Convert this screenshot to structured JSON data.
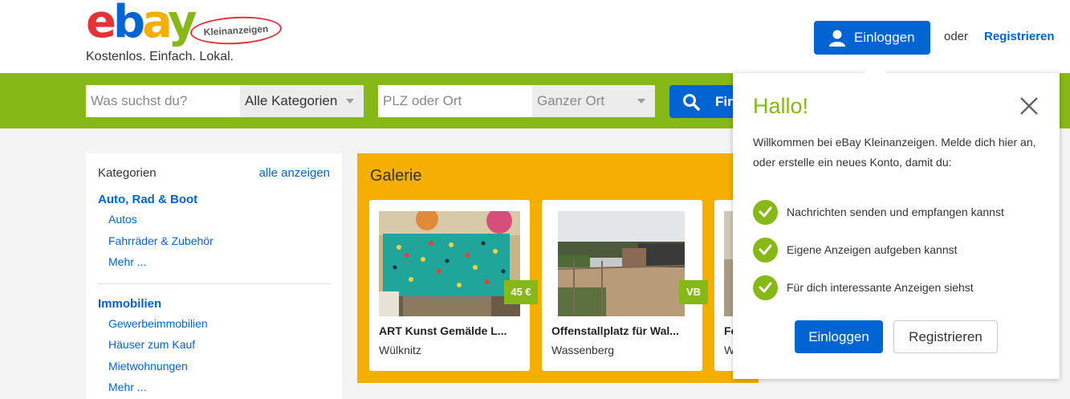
{
  "header": {
    "logo_word": [
      "e",
      "b",
      "a",
      "y"
    ],
    "logo_badge": "Kleinanzeigen",
    "tagline": "Kostenlos. Einfach. Lokal.",
    "login_label": "Einloggen",
    "or_label": "oder",
    "register_label": "Registrieren"
  },
  "search": {
    "query_placeholder": "Was suchst du?",
    "category_selected": "Alle Kategorien",
    "location_placeholder": "PLZ oder Ort",
    "radius_selected": "Ganzer Ort",
    "find_label": "Finden"
  },
  "categories": {
    "title": "Kategorien",
    "all_link": "alle anzeigen",
    "groups": [
      {
        "name": "Auto, Rad & Boot",
        "items": [
          "Autos",
          "Fahrräder & Zubehör",
          "Mehr ..."
        ]
      },
      {
        "name": "Immobilien",
        "items": [
          "Gewerbeimmobilien",
          "Häuser zum Kauf",
          "Mietwohnungen",
          "Mehr ..."
        ]
      }
    ]
  },
  "gallery": {
    "title": "Galerie",
    "cards": [
      {
        "title": "ART Kunst Gemälde L...",
        "location": "Wülknitz",
        "price": "45 €"
      },
      {
        "title": "Offenstallplatz für Wal...",
        "location": "Wassenberg",
        "price": "VB"
      },
      {
        "title": "Fe",
        "location": "W",
        "price": ""
      }
    ]
  },
  "popover": {
    "title": "Hallo!",
    "text": "Willkommen bei eBay Kleinanzeigen. Melde dich hier an, oder erstelle ein neues Konto, damit du:",
    "benefits": [
      "Nachrichten senden und empfangen kannst",
      "Eigene Anzeigen aufgeben kannst",
      "Für dich interessante Anzeigen siehst"
    ],
    "login_label": "Einloggen",
    "register_label": "Registrieren"
  },
  "colors": {
    "ebay_red": "#e53238",
    "ebay_blue": "#0064d2",
    "ebay_yellow": "#f5af02",
    "ebay_green": "#86b817"
  }
}
